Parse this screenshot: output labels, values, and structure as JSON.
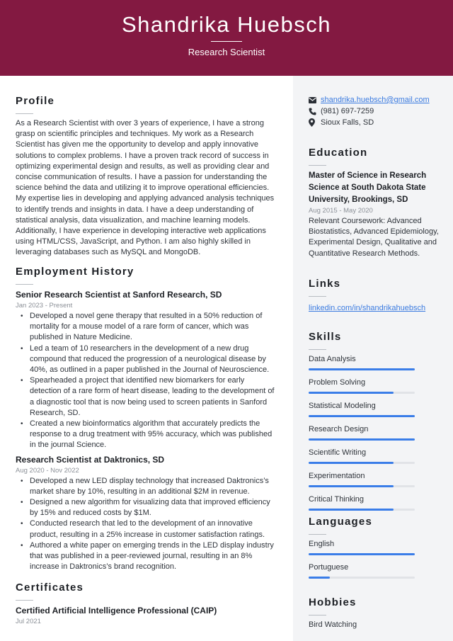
{
  "header": {
    "name": "Shandrika Huebsch",
    "job_title": "Research Scientist",
    "background_color": "#831941"
  },
  "profile": {
    "heading": "Profile",
    "text": "As a Research Scientist with over 3 years of experience, I have a strong grasp on scientific principles and techniques. My work as a Research Scientist has given me the opportunity to develop and apply innovative solutions to complex problems. I have a proven track record of success in optimizing experimental design and results, as well as providing clear and concise communication of results. I have a passion for understanding the science behind the data and utilizing it to improve operational efficiencies. My expertise lies in developing and applying advanced analysis techniques to identify trends and insights in data. I have a deep understanding of statistical analysis, data visualization, and machine learning models. Additionally, I have experience in developing interactive web applications using HTML/CSS, JavaScript, and Python. I am also highly skilled in leveraging databases such as MySQL and MongoDB."
  },
  "employment": {
    "heading": "Employment History",
    "jobs": [
      {
        "title": "Senior Research Scientist at Sanford Research, SD",
        "dates": "Jan 2023 - Present",
        "bullets": [
          "Developed a novel gene therapy that resulted in a 50% reduction of mortality for a mouse model of a rare form of cancer, which was published in Nature Medicine.",
          "Led a team of 10 researchers in the development of a new drug compound that reduced the progression of a neurological disease by 40%, as outlined in a paper published in the Journal of Neuroscience.",
          "Spearheaded a project that identified new biomarkers for early detection of a rare form of heart disease, leading to the development of a diagnostic tool that is now being used to screen patients in Sanford Research, SD.",
          "Created a new bioinformatics algorithm that accurately predicts the response to a drug treatment with 95% accuracy, which was published in the journal Science."
        ]
      },
      {
        "title": "Research Scientist at Daktronics, SD",
        "dates": "Aug 2020 - Nov 2022",
        "bullets": [
          "Developed a new LED display technology that increased Daktronics’s market share by 10%, resulting in an additional $2M in revenue.",
          "Designed a new algorithm for visualizing data that improved efficiency by 15% and reduced costs by $1M.",
          "Conducted research that led to the development of an innovative product, resulting in a 25% increase in customer satisfaction ratings.",
          "Authored a white paper on emerging trends in the LED display industry that was published in a peer-reviewed journal, resulting in an 8% increase in Daktronics’s brand recognition."
        ]
      }
    ]
  },
  "certificates": {
    "heading": "Certificates",
    "items": [
      {
        "title": "Certified Artificial Intelligence Professional (CAIP)",
        "date": "Jul 2021"
      }
    ]
  },
  "contact": {
    "email": "shandrika.huebsch@gmail.com",
    "phone": "(981) 697-7259",
    "location": "Sioux Falls, SD",
    "icons": [
      "envelope-icon",
      "phone-icon",
      "map-pin-icon"
    ]
  },
  "education": {
    "heading": "Education",
    "degree": "Master of Science in Research Science at South Dakota State University, Brookings, SD",
    "dates": "Aug 2015 - May 2020",
    "description": "Relevant Coursework: Advanced Biostatistics, Advanced Epidemiology, Experimental Design, Qualitative and Quantitative Research Methods."
  },
  "links": {
    "heading": "Links",
    "items": [
      "linkedin.com/in/shandrikahuebsch"
    ]
  },
  "skills": {
    "heading": "Skills",
    "accent_color": "#3a7de8",
    "items": [
      {
        "label": "Data Analysis",
        "level": 1.0
      },
      {
        "label": "Problem Solving",
        "level": 0.8
      },
      {
        "label": "Statistical Modeling",
        "level": 1.0
      },
      {
        "label": "Research Design",
        "level": 1.0
      },
      {
        "label": "Scientific Writing",
        "level": 0.8
      },
      {
        "label": "Experimentation",
        "level": 0.8
      },
      {
        "label": "Critical Thinking",
        "level": 0.8
      }
    ]
  },
  "languages": {
    "heading": "Languages",
    "items": [
      {
        "label": "English",
        "level": 1.0
      },
      {
        "label": "Portuguese",
        "level": 0.2
      }
    ]
  },
  "hobbies": {
    "heading": "Hobbies",
    "items": [
      "Bird Watching"
    ]
  }
}
